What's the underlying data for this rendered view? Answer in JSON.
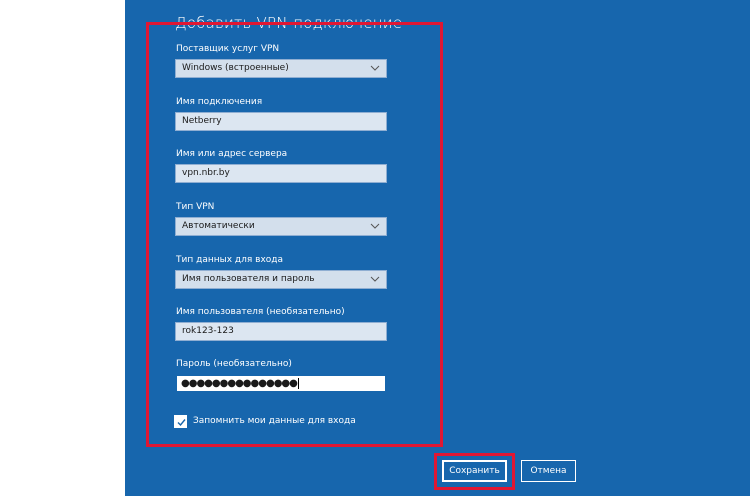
{
  "dialog": {
    "title": "Добавить VPN-подключение"
  },
  "form": {
    "provider": {
      "label": "Поставщик услуг VPN",
      "value": "Windows (встроенные)"
    },
    "connection_name": {
      "label": "Имя подключения",
      "value": "Netberry"
    },
    "server": {
      "label": "Имя или адрес сервера",
      "value": "vpn.nbr.by"
    },
    "vpn_type": {
      "label": "Тип VPN",
      "value": "Автоматически"
    },
    "signin_type": {
      "label": "Тип данных для входа",
      "value": "Имя пользователя и пароль"
    },
    "username": {
      "label": "Имя пользователя (необязательно)",
      "value": "rok123-123"
    },
    "password": {
      "label": "Пароль (необязательно)",
      "value": "●●●●●●●●●●●●●●●"
    },
    "remember": {
      "label": "Запомнить мои данные для входа",
      "checked": true
    }
  },
  "buttons": {
    "save": "Сохранить",
    "cancel": "Отмена"
  },
  "colors": {
    "dialog_bg": "#1766ad",
    "highlight": "#e01733",
    "field_bg": "#dce6f1"
  },
  "icons": {
    "dropdown": "chevron-down-icon",
    "checkbox": "checkmark-icon"
  }
}
